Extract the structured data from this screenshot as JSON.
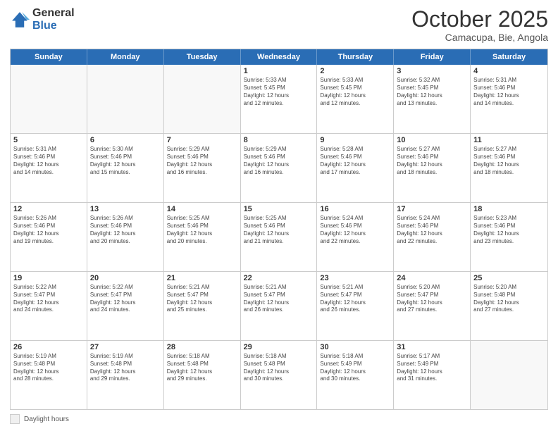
{
  "header": {
    "logo_general": "General",
    "logo_blue": "Blue",
    "month_title": "October 2025",
    "subtitle": "Camacupa, Bie, Angola"
  },
  "weekdays": [
    "Sunday",
    "Monday",
    "Tuesday",
    "Wednesday",
    "Thursday",
    "Friday",
    "Saturday"
  ],
  "weeks": [
    [
      {
        "day": "",
        "info": "",
        "empty": true
      },
      {
        "day": "",
        "info": "",
        "empty": true
      },
      {
        "day": "",
        "info": "",
        "empty": true
      },
      {
        "day": "1",
        "info": "Sunrise: 5:33 AM\nSunset: 5:45 PM\nDaylight: 12 hours\nand 12 minutes.",
        "empty": false
      },
      {
        "day": "2",
        "info": "Sunrise: 5:33 AM\nSunset: 5:45 PM\nDaylight: 12 hours\nand 12 minutes.",
        "empty": false
      },
      {
        "day": "3",
        "info": "Sunrise: 5:32 AM\nSunset: 5:45 PM\nDaylight: 12 hours\nand 13 minutes.",
        "empty": false
      },
      {
        "day": "4",
        "info": "Sunrise: 5:31 AM\nSunset: 5:46 PM\nDaylight: 12 hours\nand 14 minutes.",
        "empty": false
      }
    ],
    [
      {
        "day": "5",
        "info": "Sunrise: 5:31 AM\nSunset: 5:46 PM\nDaylight: 12 hours\nand 14 minutes.",
        "empty": false
      },
      {
        "day": "6",
        "info": "Sunrise: 5:30 AM\nSunset: 5:46 PM\nDaylight: 12 hours\nand 15 minutes.",
        "empty": false
      },
      {
        "day": "7",
        "info": "Sunrise: 5:29 AM\nSunset: 5:46 PM\nDaylight: 12 hours\nand 16 minutes.",
        "empty": false
      },
      {
        "day": "8",
        "info": "Sunrise: 5:29 AM\nSunset: 5:46 PM\nDaylight: 12 hours\nand 16 minutes.",
        "empty": false
      },
      {
        "day": "9",
        "info": "Sunrise: 5:28 AM\nSunset: 5:46 PM\nDaylight: 12 hours\nand 17 minutes.",
        "empty": false
      },
      {
        "day": "10",
        "info": "Sunrise: 5:27 AM\nSunset: 5:46 PM\nDaylight: 12 hours\nand 18 minutes.",
        "empty": false
      },
      {
        "day": "11",
        "info": "Sunrise: 5:27 AM\nSunset: 5:46 PM\nDaylight: 12 hours\nand 18 minutes.",
        "empty": false
      }
    ],
    [
      {
        "day": "12",
        "info": "Sunrise: 5:26 AM\nSunset: 5:46 PM\nDaylight: 12 hours\nand 19 minutes.",
        "empty": false
      },
      {
        "day": "13",
        "info": "Sunrise: 5:26 AM\nSunset: 5:46 PM\nDaylight: 12 hours\nand 20 minutes.",
        "empty": false
      },
      {
        "day": "14",
        "info": "Sunrise: 5:25 AM\nSunset: 5:46 PM\nDaylight: 12 hours\nand 20 minutes.",
        "empty": false
      },
      {
        "day": "15",
        "info": "Sunrise: 5:25 AM\nSunset: 5:46 PM\nDaylight: 12 hours\nand 21 minutes.",
        "empty": false
      },
      {
        "day": "16",
        "info": "Sunrise: 5:24 AM\nSunset: 5:46 PM\nDaylight: 12 hours\nand 22 minutes.",
        "empty": false
      },
      {
        "day": "17",
        "info": "Sunrise: 5:24 AM\nSunset: 5:46 PM\nDaylight: 12 hours\nand 22 minutes.",
        "empty": false
      },
      {
        "day": "18",
        "info": "Sunrise: 5:23 AM\nSunset: 5:46 PM\nDaylight: 12 hours\nand 23 minutes.",
        "empty": false
      }
    ],
    [
      {
        "day": "19",
        "info": "Sunrise: 5:22 AM\nSunset: 5:47 PM\nDaylight: 12 hours\nand 24 minutes.",
        "empty": false
      },
      {
        "day": "20",
        "info": "Sunrise: 5:22 AM\nSunset: 5:47 PM\nDaylight: 12 hours\nand 24 minutes.",
        "empty": false
      },
      {
        "day": "21",
        "info": "Sunrise: 5:21 AM\nSunset: 5:47 PM\nDaylight: 12 hours\nand 25 minutes.",
        "empty": false
      },
      {
        "day": "22",
        "info": "Sunrise: 5:21 AM\nSunset: 5:47 PM\nDaylight: 12 hours\nand 26 minutes.",
        "empty": false
      },
      {
        "day": "23",
        "info": "Sunrise: 5:21 AM\nSunset: 5:47 PM\nDaylight: 12 hours\nand 26 minutes.",
        "empty": false
      },
      {
        "day": "24",
        "info": "Sunrise: 5:20 AM\nSunset: 5:47 PM\nDaylight: 12 hours\nand 27 minutes.",
        "empty": false
      },
      {
        "day": "25",
        "info": "Sunrise: 5:20 AM\nSunset: 5:48 PM\nDaylight: 12 hours\nand 27 minutes.",
        "empty": false
      }
    ],
    [
      {
        "day": "26",
        "info": "Sunrise: 5:19 AM\nSunset: 5:48 PM\nDaylight: 12 hours\nand 28 minutes.",
        "empty": false
      },
      {
        "day": "27",
        "info": "Sunrise: 5:19 AM\nSunset: 5:48 PM\nDaylight: 12 hours\nand 29 minutes.",
        "empty": false
      },
      {
        "day": "28",
        "info": "Sunrise: 5:18 AM\nSunset: 5:48 PM\nDaylight: 12 hours\nand 29 minutes.",
        "empty": false
      },
      {
        "day": "29",
        "info": "Sunrise: 5:18 AM\nSunset: 5:48 PM\nDaylight: 12 hours\nand 30 minutes.",
        "empty": false
      },
      {
        "day": "30",
        "info": "Sunrise: 5:18 AM\nSunset: 5:49 PM\nDaylight: 12 hours\nand 30 minutes.",
        "empty": false
      },
      {
        "day": "31",
        "info": "Sunrise: 5:17 AM\nSunset: 5:49 PM\nDaylight: 12 hours\nand 31 minutes.",
        "empty": false
      },
      {
        "day": "",
        "info": "",
        "empty": true
      }
    ]
  ],
  "legend": {
    "label": "Daylight hours"
  }
}
